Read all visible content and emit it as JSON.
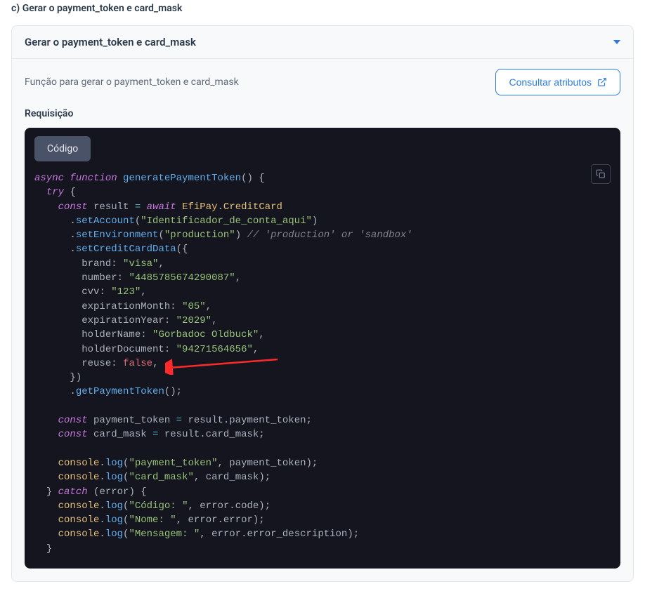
{
  "section_label": "c) Gerar o payment_token e card_mask",
  "card_title": "Gerar o payment_token e card_mask",
  "description": "Função para gerar o payment_token e card_mask",
  "attr_button": "Consultar atributos",
  "request_label": "Requisição",
  "code_tab": "Código",
  "code": {
    "l1_async": "async",
    "l1_function": "function",
    "l1_fn": "generatePaymentToken",
    "l2_try": "try",
    "l3_const": "const",
    "l3_result": "result",
    "l3_await": "await",
    "l3_efi": "EfiPay",
    "l3_cc": "CreditCard",
    "l4_setAccount": "setAccount",
    "l4_val": "\"Identificador_de_conta_aqui\"",
    "l5_setEnv": "setEnvironment",
    "l5_val": "\"production\"",
    "l5_cmt": "// 'production' or 'sandbox'",
    "l6_setCC": "setCreditCardData",
    "l7_k": "brand",
    "l7_v": "\"visa\"",
    "l8_k": "number",
    "l8_v": "\"4485785674290087\"",
    "l9_k": "cvv",
    "l9_v": "\"123\"",
    "l10_k": "expirationMonth",
    "l10_v": "\"05\"",
    "l11_k": "expirationYear",
    "l11_v": "\"2029\"",
    "l12_k": "holderName",
    "l12_v": "\"Gorbadoc Oldbuck\"",
    "l13_k": "holderDocument",
    "l13_v": "\"94271564656\"",
    "l14_k": "reuse",
    "l14_v": "false",
    "l16_get": "getPaymentToken",
    "l18_const": "const",
    "l18_pt": "payment_token",
    "l18_rhs": "result.payment_token",
    "l19_const": "const",
    "l19_cm": "card_mask",
    "l19_rhs": "result.card_mask",
    "l21_log": "log",
    "l21_s": "\"payment_token\"",
    "l21_v": "payment_token",
    "l22_log": "log",
    "l22_s": "\"card_mask\"",
    "l22_v": "card_mask",
    "l23_catch": "catch",
    "l23_err": "error",
    "l24_s": "\"Código: \"",
    "l24_v": "error.code",
    "l25_s": "\"Nome: \"",
    "l25_v": "error.error",
    "l26_s": "\"Mensagem: \"",
    "l26_v": "error.error_description",
    "console": "console"
  }
}
